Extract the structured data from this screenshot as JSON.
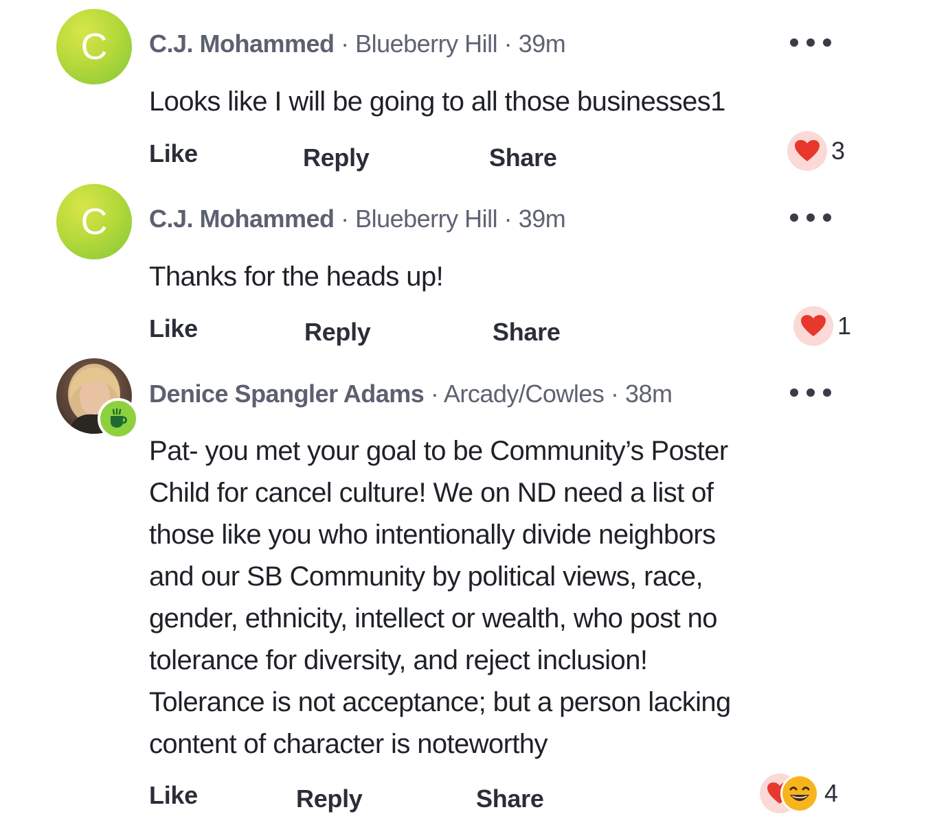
{
  "comments": [
    {
      "avatar_letter": "C",
      "author": "C.J. Mohammed",
      "neighborhood": "Blueberry Hill",
      "time": "39m",
      "lines": [
        "Looks like I will be going to all those businesses1"
      ],
      "actions": {
        "like": "Like",
        "reply": "Reply",
        "share": "Share"
      },
      "reactions": {
        "icons": [
          "heart-icon"
        ],
        "count": "3"
      }
    },
    {
      "avatar_letter": "C",
      "author": "C.J. Mohammed",
      "neighborhood": "Blueberry Hill",
      "time": "39m",
      "lines": [
        "Thanks for the heads up!"
      ],
      "actions": {
        "like": "Like",
        "reply": "Reply",
        "share": "Share"
      },
      "reactions": {
        "icons": [
          "heart-icon"
        ],
        "count": "1"
      }
    },
    {
      "avatar_letter": "",
      "author": "Denice Spangler Adams",
      "neighborhood": "Arcady/Cowles",
      "time": "38m",
      "lines": [
        "Pat- you met your goal to be Community’s Poster",
        "Child for cancel culture!  We on ND need a list of",
        "those like you who intentionally divide neighbors",
        "and our SB Community by political views, race,",
        "gender, ethnicity, intellect or wealth, who post no",
        "tolerance for diversity, and reject inclusion!",
        "Tolerance is not acceptance; but a person lacking",
        "content of character is noteworthy"
      ],
      "actions": {
        "like": "Like",
        "reply": "Reply",
        "share": "Share"
      },
      "reactions": {
        "icons": [
          "heart-icon",
          "grinning-face-icon"
        ],
        "count": "4"
      }
    }
  ],
  "separator": "·",
  "colors": {
    "avatar_green": "#b8d93a",
    "badge_green": "#8ed13f",
    "heart_red": "#e8382e",
    "reaction_bg": "#fbd9d6",
    "meta_gray": "#5e6272",
    "text_dark": "#1f2128"
  }
}
